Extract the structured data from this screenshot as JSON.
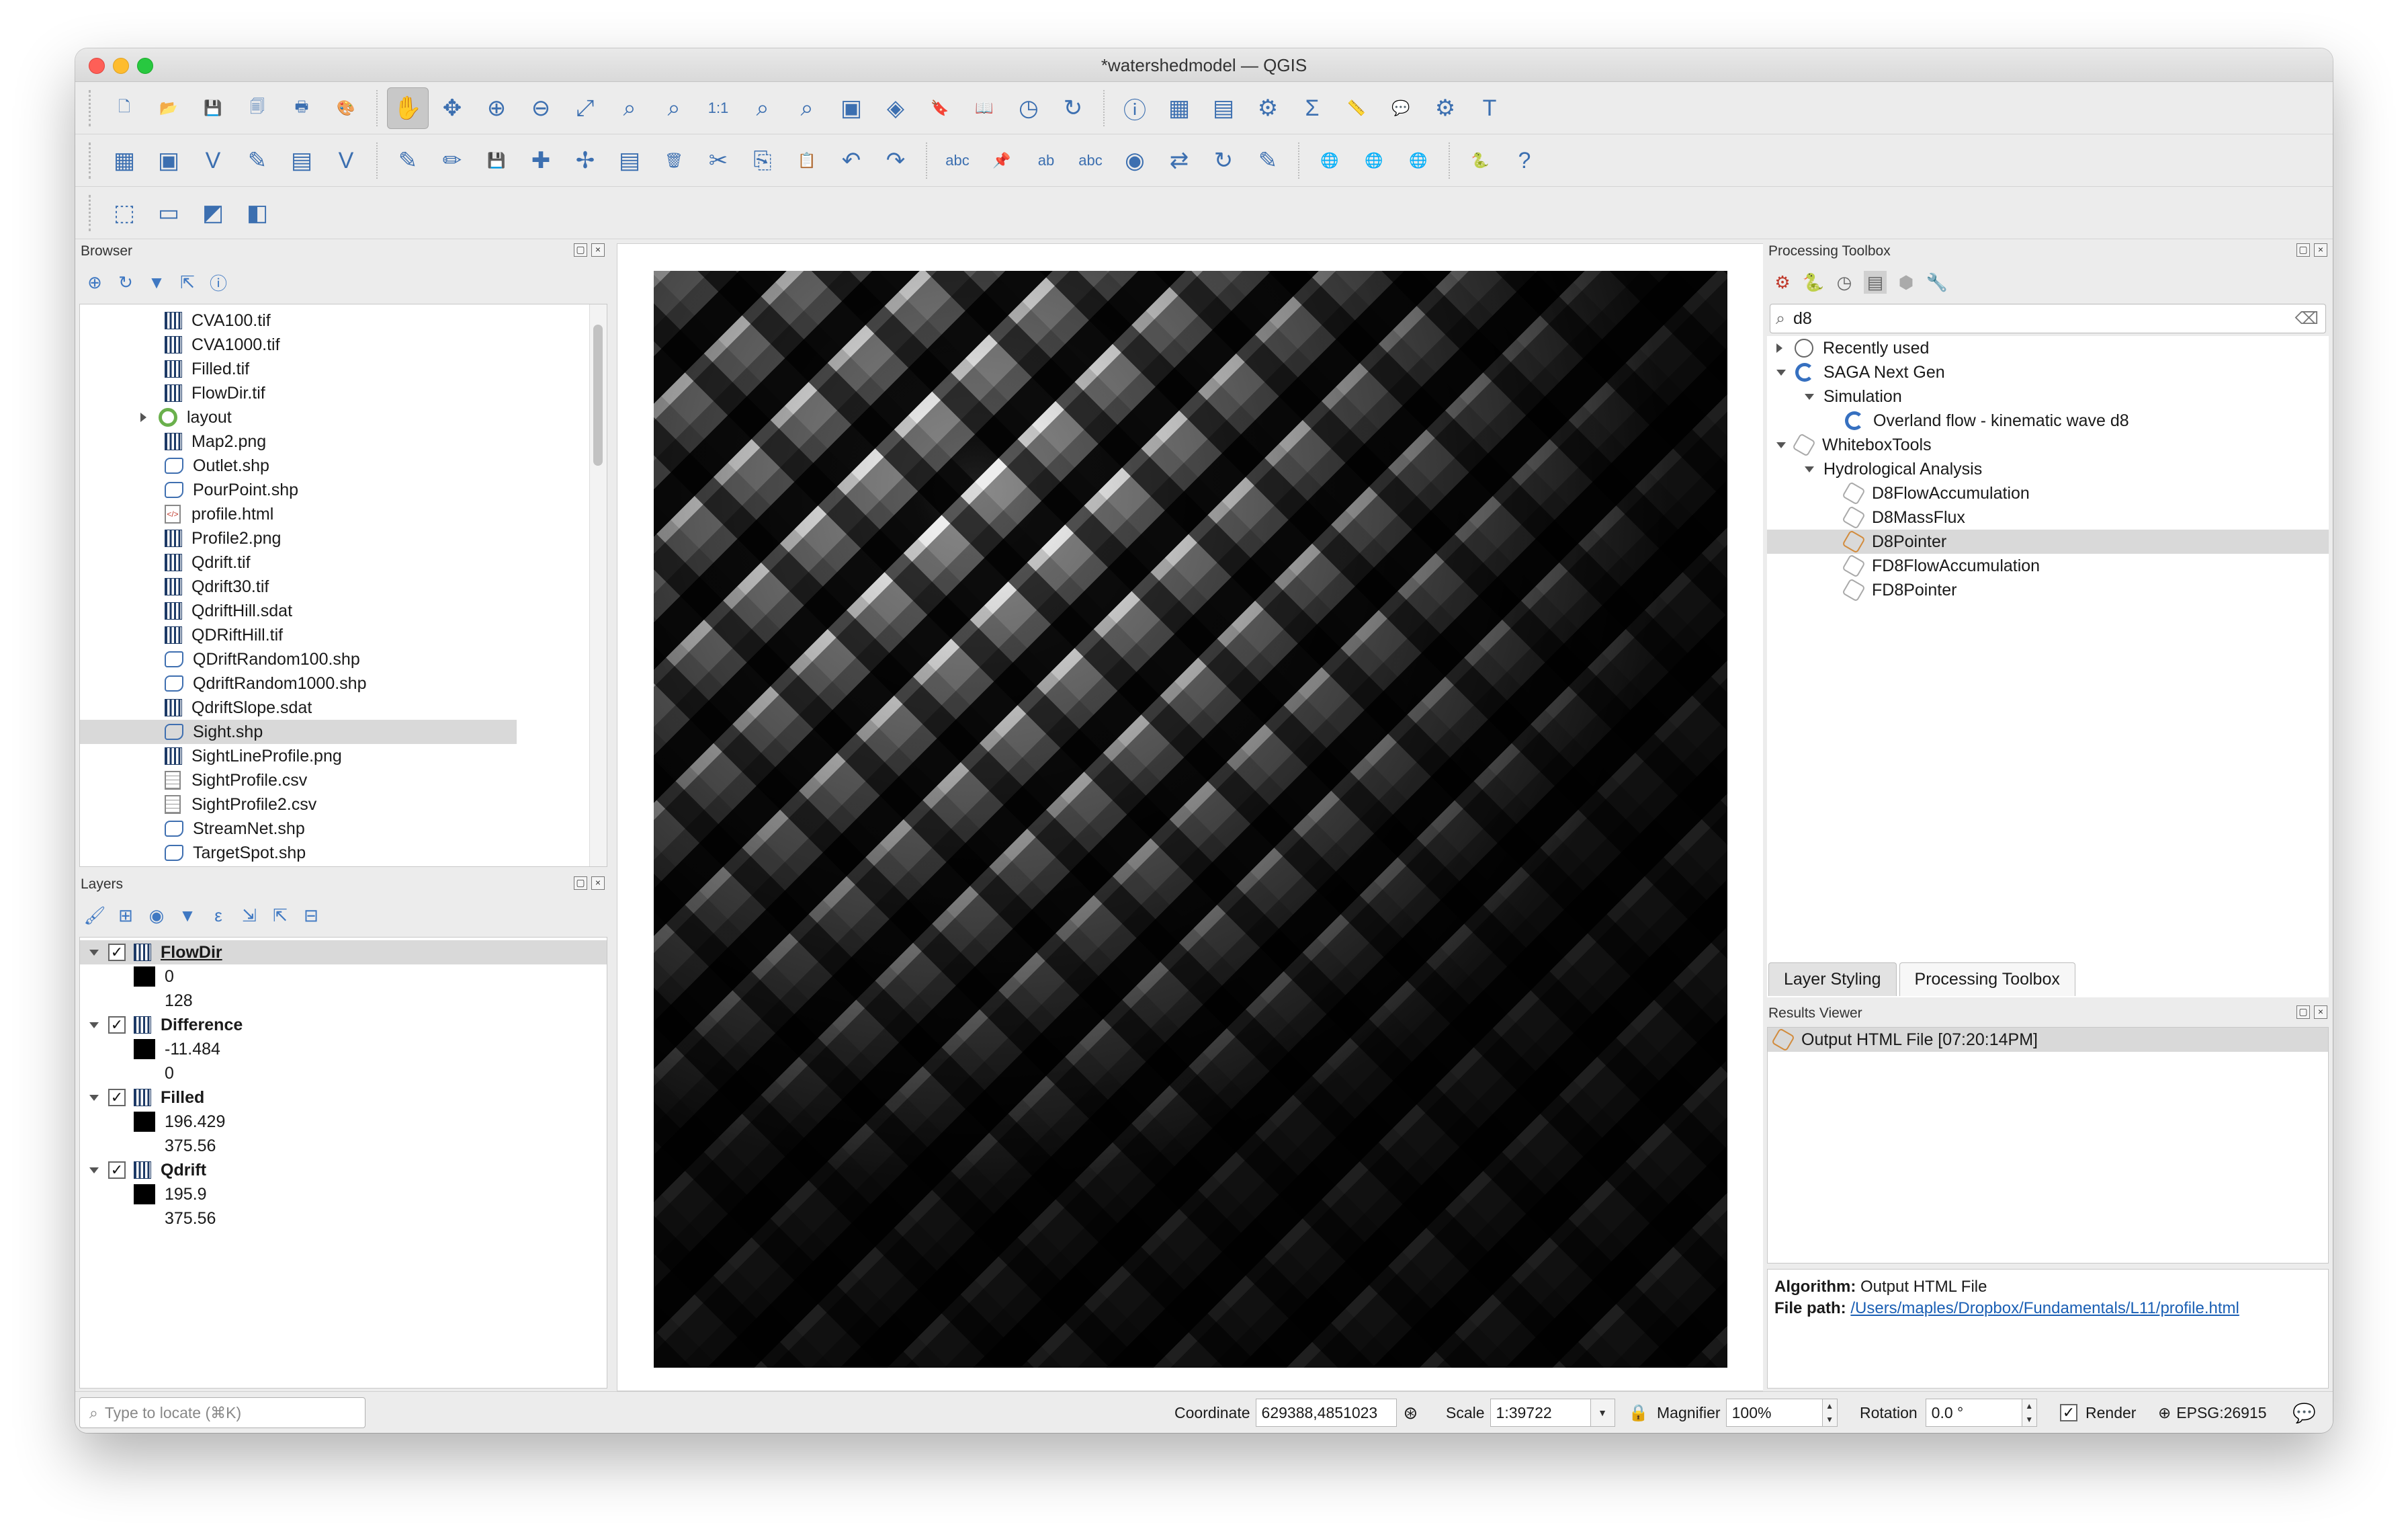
{
  "window": {
    "title": "*watershedmodel — QGIS"
  },
  "toolbars": {
    "row1_icons": [
      "new-project-icon",
      "open-project-icon",
      "save-project-icon",
      "save-as-icon",
      "print-layout-icon",
      "style-manager-icon",
      "pan-icon",
      "pan-to-selection-icon",
      "zoom-in-icon",
      "zoom-out-icon",
      "zoom-full-icon",
      "zoom-to-selection-icon",
      "zoom-to-layer-icon",
      "zoom-native-icon",
      "zoom-last-icon",
      "zoom-next-icon",
      "new-map-view-icon",
      "new-3d-view-icon",
      "new-bookmark-icon",
      "show-bookmarks-icon",
      "temporal-controller-icon",
      "refresh-icon",
      "identify-icon",
      "open-attribute-table-icon",
      "statistical-summary-icon",
      "processing-toolbox-icon",
      "sum-icon",
      "measure-icon",
      "map-tips-icon",
      "select-feature-icon",
      "text-annotation-icon"
    ],
    "row2_icons": [
      "data-source-manager-icon",
      "new-geopackage-icon",
      "new-shapefile-icon",
      "digitize-icon",
      "new-temp-layer-icon",
      "new-virtual-layer-icon",
      "edit-pencil-icon",
      "toggle-edit-icon",
      "save-edits-icon",
      "add-feature-icon",
      "vertex-tool-icon",
      "modify-attributes-icon",
      "delete-selected-icon",
      "cut-icon",
      "copy-icon",
      "paste-icon",
      "undo-icon",
      "redo-icon",
      "label-icon",
      "pin-labels-icon",
      "highlight-label-icon",
      "label-abc-icon",
      "show-hide-label-icon",
      "move-label-icon",
      "rotate-label-icon",
      "change-label-icon",
      "add-wms-icon",
      "add-wfs-icon",
      "add-wcs-icon",
      "python-console-icon",
      "help-icon"
    ],
    "row3_icons": [
      "select-by-expression-icon",
      "deselect-icon",
      "select-layer-icon",
      "attribute-form-icon"
    ]
  },
  "browser": {
    "title": "Browser",
    "items": [
      {
        "label": "CVA100.tif",
        "type": "raster"
      },
      {
        "label": "CVA1000.tif",
        "type": "raster"
      },
      {
        "label": "Filled.tif",
        "type": "raster"
      },
      {
        "label": "FlowDir.tif",
        "type": "raster"
      },
      {
        "label": "layout",
        "type": "qgis"
      },
      {
        "label": "Map2.png",
        "type": "raster"
      },
      {
        "label": "Outlet.shp",
        "type": "vector"
      },
      {
        "label": "PourPoint.shp",
        "type": "vector"
      },
      {
        "label": "profile.html",
        "type": "html"
      },
      {
        "label": "Profile2.png",
        "type": "raster"
      },
      {
        "label": "Qdrift.tif",
        "type": "raster"
      },
      {
        "label": "Qdrift30.tif",
        "type": "raster"
      },
      {
        "label": "QdriftHill.sdat",
        "type": "raster"
      },
      {
        "label": "QDRiftHill.tif",
        "type": "raster"
      },
      {
        "label": "QDriftRandom100.shp",
        "type": "vector"
      },
      {
        "label": "QdriftRandom1000.shp",
        "type": "vector"
      },
      {
        "label": "QdriftSlope.sdat",
        "type": "raster"
      },
      {
        "label": "Sight.shp",
        "type": "vector"
      },
      {
        "label": "SightLineProfile.png",
        "type": "raster"
      },
      {
        "label": "SightProfile.csv",
        "type": "table"
      },
      {
        "label": "SightProfile2.csv",
        "type": "table"
      },
      {
        "label": "StreamNet.shp",
        "type": "vector"
      },
      {
        "label": "TargetSpot.shp",
        "type": "vector"
      }
    ],
    "selected": "Sight.shp"
  },
  "layers": {
    "title": "Layers",
    "items": [
      {
        "name": "FlowDir",
        "min": "0",
        "max": "128"
      },
      {
        "name": "Difference",
        "min": "-11.484",
        "max": "0"
      },
      {
        "name": "Filled",
        "min": "196.429",
        "max": "375.56"
      },
      {
        "name": "Qdrift",
        "min": "195.9",
        "max": "375.56"
      }
    ]
  },
  "processing": {
    "title": "Processing Toolbox",
    "search_value": "d8",
    "tree": {
      "recent": "Recently used",
      "saga": "SAGA Next Gen",
      "simulation": "Simulation",
      "overland": "Overland flow - kinematic wave d8",
      "whitebox": "WhiteboxTools",
      "hydro": "Hydrological Analysis",
      "algos": [
        "D8FlowAccumulation",
        "D8MassFlux",
        "D8Pointer",
        "FD8FlowAccumulation",
        "FD8Pointer"
      ],
      "selected": "D8Pointer"
    },
    "tabs": [
      "Layer Styling",
      "Processing Toolbox"
    ],
    "active_tab": "Processing Toolbox"
  },
  "results": {
    "title": "Results Viewer",
    "item": "Output HTML File [07:20:14PM]",
    "algorithm_label": "Algorithm:",
    "algorithm_value": " Output HTML File",
    "filepath_label": "File path:",
    "filepath_value": "/Users/maples/Dropbox/Fundamentals/L11/profile.html"
  },
  "statusbar": {
    "locate_placeholder": "Type to locate (⌘K)",
    "coordinate_label": "Coordinate",
    "coordinate_value": "629388,4851023",
    "scale_label": "Scale",
    "scale_value": "1:39722",
    "magnifier_label": "Magnifier",
    "magnifier_value": "100%",
    "rotation_label": "Rotation",
    "rotation_value": "0.0 °",
    "render_label": "Render",
    "crs_label": "EPSG:26915"
  },
  "colors": {
    "link": "#1a5fb4",
    "selection": "#d9d9d9",
    "accent": "#3670c0"
  }
}
